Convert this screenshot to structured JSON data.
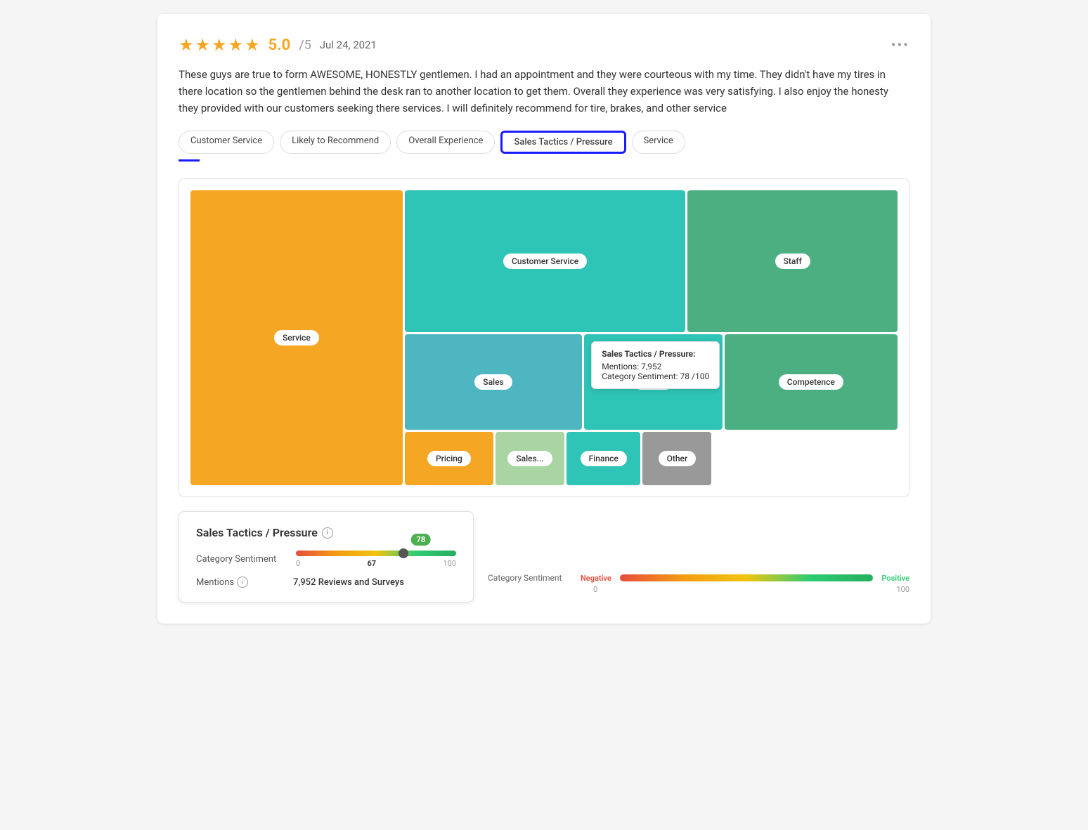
{
  "review": {
    "stars": 5,
    "rating": "5.0",
    "ratingMax": "/5",
    "date": "Jul 24, 2021",
    "text": "These guys are true to form AWESOME, HONESTLY gentlemen. I had an appointment and they were courteous with my time. They didn't have my tires in there location so the gentlemen behind the desk ran to another location to get them. Overall they experience was very satisfying. I also enjoy the honesty they provided with our customers seeking there services. I will definitely recommend for tire, brakes, and other service",
    "moreOptions": "•••"
  },
  "tags": [
    {
      "id": "customer-service",
      "label": "Customer Service",
      "active": false
    },
    {
      "id": "likely-to-recommend",
      "label": "Likely to Recommend",
      "active": false
    },
    {
      "id": "overall-experience",
      "label": "Overall Experience",
      "active": false
    },
    {
      "id": "sales-tactics",
      "label": "Sales Tactics / Pressure",
      "active": true
    },
    {
      "id": "service",
      "label": "Service",
      "active": false
    }
  ],
  "treemap": {
    "cells": {
      "service": "Service",
      "customerService": "Customer Service",
      "staff": "Staff",
      "sales": "Sales",
      "speed": "Speed",
      "competence": "Competence",
      "pricing": "Pricing",
      "salesSmall": "Sales...",
      "finance": "Finance",
      "other": "Other"
    },
    "tooltip": {
      "title": "Sales Tactics / Pressure:",
      "mentions": "Mentions: 7,952",
      "sentiment": "Category Sentiment: 78 /100"
    }
  },
  "infoCard": {
    "title": "Sales Tactics / Pressure",
    "infoIcon": "i",
    "sentimentLabel": "Category Sentiment",
    "sentimentValue": 78,
    "sentimentThumbPct": 67,
    "sentimentMin": "0",
    "sentimentCurrent": "67",
    "sentimentMax": "100",
    "mentionsLabel": "Mentions",
    "mentionsValue": "7,952 Reviews and Surveys"
  },
  "legend": {
    "label": "Category Sentiment",
    "negative": "Negative",
    "positive": "Positive",
    "min": "0",
    "max": "100"
  }
}
